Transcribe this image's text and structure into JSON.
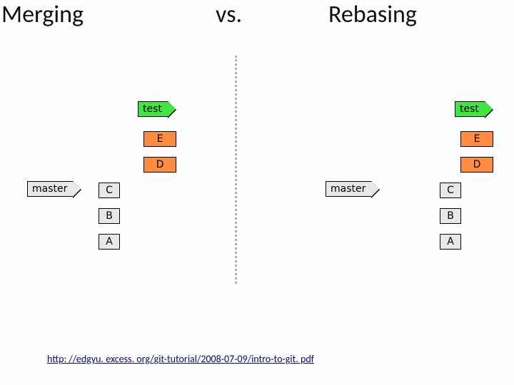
{
  "header": {
    "left": "Merging",
    "center": "vs.",
    "right": "Rebasing"
  },
  "branches": {
    "test": "test",
    "master": "master"
  },
  "commits": {
    "E": "E",
    "D": "D",
    "C": "C",
    "B": "B",
    "A": "A"
  },
  "footer": {
    "url": "http: //edgyu. excess. org/git-tutorial/2008-07-09/intro-to-git. pdf"
  }
}
